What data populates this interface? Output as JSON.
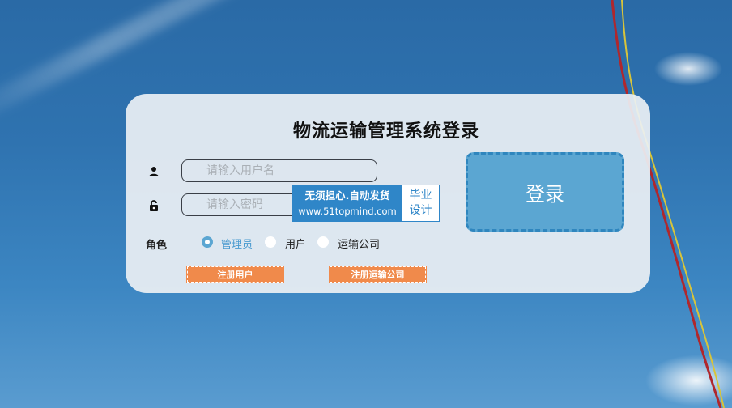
{
  "login_form": {
    "title": "物流运输管理系统登录",
    "username": {
      "placeholder": "请输入用户名",
      "value": "",
      "icon": "user-icon"
    },
    "password": {
      "placeholder": "请输入密码",
      "value": "",
      "icon": "lock-icon"
    },
    "login_button_label": "登录",
    "role": {
      "label": "角色",
      "options": [
        "管理员",
        "用户",
        "运输公司"
      ],
      "selected": "管理员"
    },
    "register_user_label": "注册用户",
    "register_company_label": "注册运输公司"
  },
  "watermark": {
    "line1": "无须担心.自动发货",
    "line2": "www.51topmind.com",
    "badge_line1": "毕业",
    "badge_line2": "设计"
  },
  "colors": {
    "accent": "#5ba6d2",
    "register_button": "#f08a4b",
    "card_background": "#eceff4",
    "sky": "#2f73b0"
  }
}
